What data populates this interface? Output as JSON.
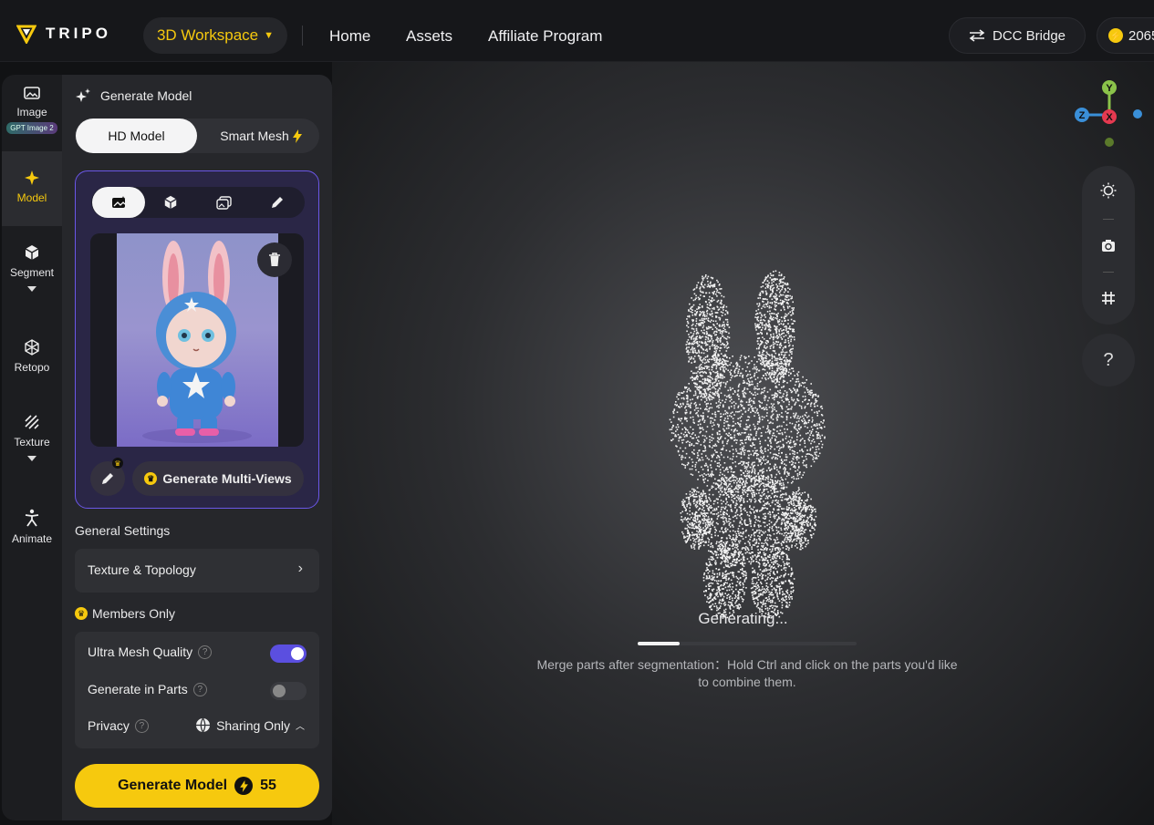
{
  "brand": {
    "name": "TRIPO"
  },
  "header": {
    "workspace_label": "3D Workspace",
    "nav": [
      "Home",
      "Assets",
      "Affiliate Program"
    ],
    "dcc_label": "DCC Bridge",
    "credits": "2065"
  },
  "rail": {
    "items": [
      {
        "label": "Image",
        "badge": "GPT Image 2",
        "icon": "image-icon"
      },
      {
        "label": "Model",
        "icon": "sparkle-icon",
        "active": true
      },
      {
        "label": "Segment",
        "icon": "cube-icon"
      },
      {
        "label": "Retopo",
        "icon": "mesh-icon"
      },
      {
        "label": "Texture",
        "icon": "hatch-icon"
      },
      {
        "label": "Animate",
        "icon": "figure-icon"
      }
    ]
  },
  "panel": {
    "title": "Generate Model",
    "mode_options": [
      "HD Model",
      "Smart Mesh"
    ],
    "selected_mode": "HD Model",
    "input_tabs": [
      "image-upload-icon",
      "cube-icon",
      "multi-image-icon",
      "pencil-icon"
    ],
    "multiview_label": "Generate Multi-Views",
    "general_settings_label": "General Settings",
    "texture_topology_label": "Texture & Topology",
    "members_only_label": "Members Only",
    "ultra_mesh_label": "Ultra Mesh Quality",
    "ultra_mesh_on": true,
    "gen_parts_label": "Generate in Parts",
    "gen_parts_on": false,
    "privacy_label": "Privacy",
    "privacy_value": "Sharing Only",
    "generate_label": "Generate Model",
    "generate_cost": "55"
  },
  "viewport": {
    "status": "Generating...",
    "progress": 0.19,
    "hint": "Merge parts after segmentation：Hold Ctrl and click on the parts you'd like to combine them.",
    "axis_labels": [
      "Y",
      "Z",
      "X"
    ],
    "help_label": "?"
  },
  "colors": {
    "accent": "#f6c90e",
    "purple": "#6b57e8",
    "toggle_on": "#5b4fe0"
  }
}
